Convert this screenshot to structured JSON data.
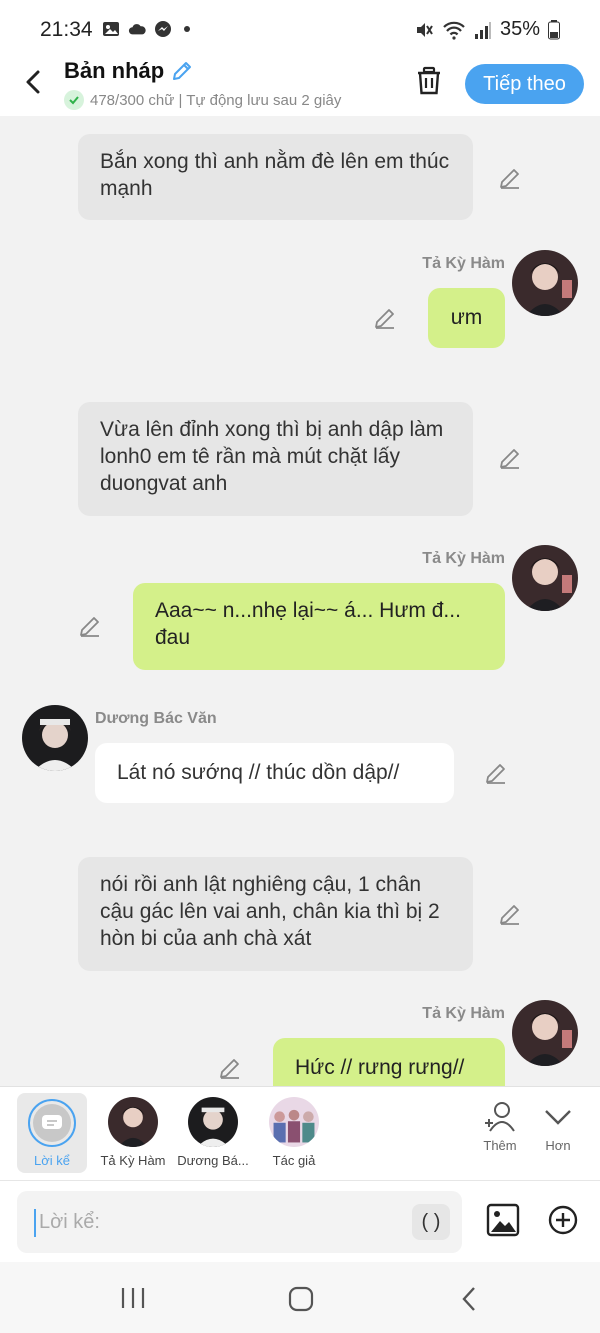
{
  "status": {
    "time": "21:34",
    "battery": "35%"
  },
  "header": {
    "title": "Bản nháp",
    "subtitle": "478/300 chữ | Tự động lưu sau 2 giây",
    "next_label": "Tiếp theo"
  },
  "messages": [
    {
      "type": "narration",
      "text": "Bắn xong thì anh nằm đè lên em thúc mạnh"
    },
    {
      "type": "right",
      "sender": "Tả Kỳ Hàm",
      "text": "ưm"
    },
    {
      "type": "narration",
      "text": "Vừa lên đỉnh xong thì bị anh dập làm lonh0 em tê rần mà mút chặt lấy duongvat anh"
    },
    {
      "type": "right",
      "sender": "Tả Kỳ Hàm",
      "text": "Aaa~~ n...nhẹ lại~~ á... Hưm đ... đau"
    },
    {
      "type": "left",
      "sender": "Dương Bác Văn",
      "text": "Lát nó sướnq // thúc dồn dập//"
    },
    {
      "type": "narration",
      "text": "nói rồi anh lật nghiêng cậu, 1 chân cậu gác lên vai anh, chân kia thì bị 2 hòn bi của anh chà xát"
    },
    {
      "type": "right",
      "sender": "Tả Kỳ Hàm",
      "text": "Hức // rưng rưng//"
    }
  ],
  "selector": {
    "items": [
      {
        "label": "Lời kể"
      },
      {
        "label": "Tả Kỳ Hàm"
      },
      {
        "label": "Dương Bá..."
      },
      {
        "label": "Tác giả"
      }
    ],
    "add_label": "Thêm",
    "more_label": "Hơn"
  },
  "input": {
    "placeholder": "Lời kể:",
    "paren_label": "( )"
  },
  "colors": {
    "accent": "#4aa3f0",
    "bubble_green": "#d4f08a",
    "narration_bg": "#e6e6e6",
    "background": "#f2f2f2"
  },
  "icons": [
    "image-icon",
    "cloud-icon",
    "messenger-icon",
    "mute-icon",
    "wifi-icon",
    "signal-icon",
    "battery-icon",
    "back-icon",
    "pencil-icon",
    "check-icon",
    "trash-icon",
    "add-person-icon",
    "chevron-down-icon",
    "picture-icon",
    "plus-circle-icon",
    "recents-icon",
    "home-icon",
    "nav-back-icon"
  ]
}
